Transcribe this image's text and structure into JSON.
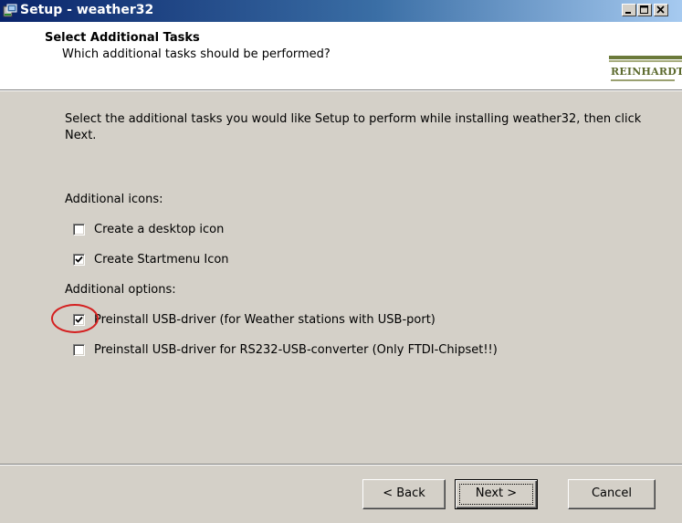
{
  "window": {
    "title": "Setup - weather32"
  },
  "header": {
    "title": "Select Additional Tasks",
    "subtitle": "Which additional tasks should be performed?",
    "logo_text": "REINHARDT"
  },
  "body": {
    "intro": "Select the additional tasks you would like Setup to perform while installing weather32, then click Next.",
    "group1_label": "Additional icons:",
    "group1_items": [
      {
        "label": "Create a desktop icon",
        "checked": false
      },
      {
        "label": "Create Startmenu Icon",
        "checked": true
      }
    ],
    "group2_label": "Additional options:",
    "group2_items": [
      {
        "label": "Preinstall USB-driver (for Weather stations with USB-port)",
        "checked": true
      },
      {
        "label": "Preinstall USB-driver for RS232-USB-converter (Only FTDI-Chipset!!)",
        "checked": false
      }
    ]
  },
  "buttons": {
    "back": "< Back",
    "next": "Next >",
    "cancel": "Cancel"
  },
  "colors": {
    "titlebar_start": "#0a246a",
    "titlebar_end": "#a6caf0",
    "dialog_bg": "#d4d0c8",
    "annotation": "#d42020",
    "logo": "#5c6a2e"
  }
}
